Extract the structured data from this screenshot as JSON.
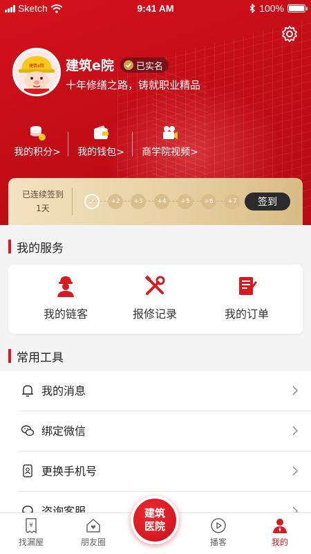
{
  "status_bar": {
    "carrier": "Sketch",
    "time": "9:41 AM",
    "battery": "100%"
  },
  "profile": {
    "name": "建筑e院",
    "verified_label": "已实名",
    "slogan": "十年修缮之路，铸就职业精品",
    "avatar_badge": "建筑e院"
  },
  "quick_links": [
    {
      "label": "我的积分>",
      "icon": "coins-icon"
    },
    {
      "label": "我的钱包>",
      "icon": "wallet-icon"
    },
    {
      "label": "商学院视频>",
      "icon": "video-camera-icon"
    }
  ],
  "signin": {
    "streak_label": "已连续签到",
    "streak_value": "1天",
    "days": [
      "✓",
      "+2",
      "+3",
      "+4",
      "+5",
      "+6",
      "+7"
    ],
    "button": "签到"
  },
  "services": {
    "title": "我的服务",
    "items": [
      {
        "label": "我的链客",
        "icon": "worker-icon"
      },
      {
        "label": "报修记录",
        "icon": "tools-icon"
      },
      {
        "label": "我的订单",
        "icon": "order-icon"
      }
    ]
  },
  "tools": {
    "title": "常用工具",
    "items": [
      {
        "label": "我的消息",
        "icon": "bell-icon"
      },
      {
        "label": "绑定微信",
        "icon": "wechat-icon"
      },
      {
        "label": "更换手机号",
        "icon": "phone-icon"
      },
      {
        "label": "咨询客服",
        "icon": "headset-icon"
      }
    ]
  },
  "tabbar": {
    "items": [
      {
        "label": "找漏屋",
        "icon": "receipt-icon"
      },
      {
        "label": "朋友圈",
        "icon": "house-heart-icon"
      },
      {
        "label": "播客",
        "icon": "play-icon"
      },
      {
        "label": "我的",
        "icon": "user-icon"
      }
    ],
    "center": "建筑\n医院",
    "active": "我的"
  },
  "colors": {
    "brand_red": "#d71920",
    "gold": "#e9d3a6",
    "dark_button": "#2b2b2b"
  }
}
